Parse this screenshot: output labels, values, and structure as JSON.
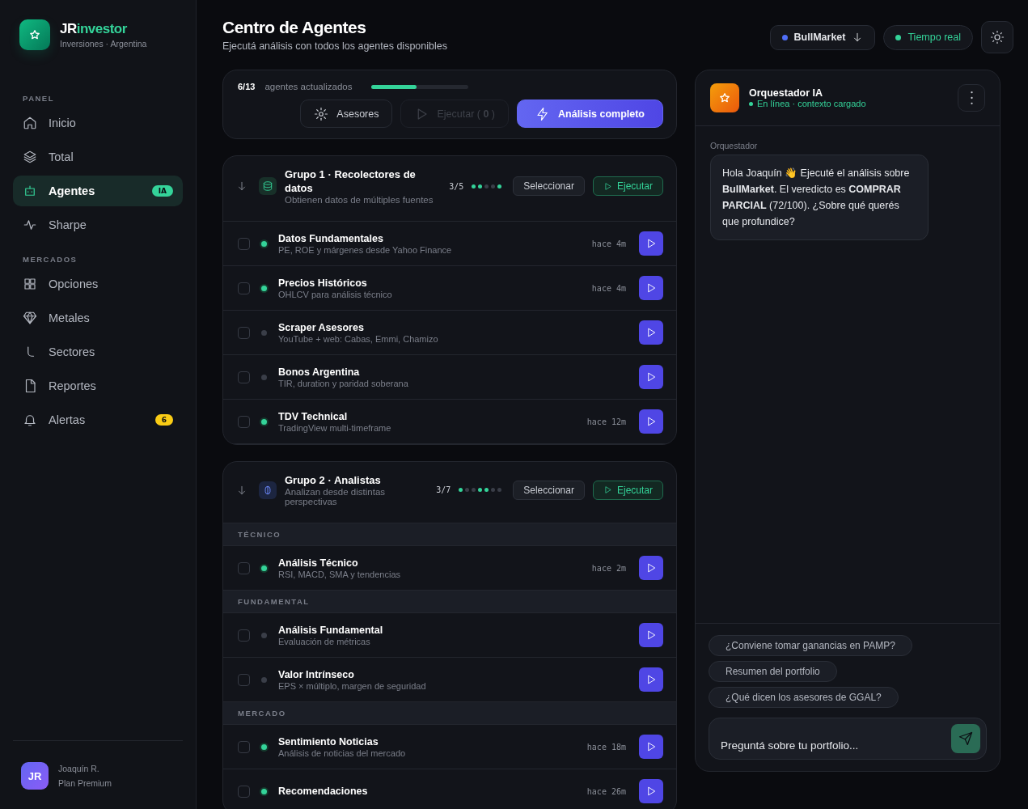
{
  "brand": {
    "name_main": "JR",
    "name_accent": "investor",
    "tagline": "Inversiones · Argentina"
  },
  "sidebar": {
    "sections": [
      {
        "label": "PANEL",
        "items": [
          {
            "label": "Inicio",
            "selected": false
          },
          {
            "label": "Total",
            "selected": false
          },
          {
            "label": "Agentes",
            "selected": true,
            "badge": {
              "text": "IA",
              "color": "#34d399"
            }
          },
          {
            "label": "Sharpe",
            "selected": false
          }
        ]
      },
      {
        "label": "MERCADOS",
        "items": [
          {
            "label": "Opciones",
            "selected": false
          },
          {
            "label": "Metales",
            "selected": false
          },
          {
            "label": "Sectores",
            "selected": false
          },
          {
            "label": "Reportes",
            "selected": false
          },
          {
            "label": "Alertas",
            "selected": false,
            "badge": {
              "text": "6",
              "color": "#facc15"
            }
          }
        ]
      }
    ],
    "user": {
      "initials": "JR",
      "name": "Joaquín R.",
      "plan": "Plan Premium"
    }
  },
  "header": {
    "title": "Centro de Agentes",
    "subtitle": "Ejecutá análisis con todos los agentes disponibles",
    "broker": {
      "label": "BullMarket",
      "color": "#4f6ef7"
    },
    "status": {
      "label": "Tiempo real",
      "color": "#34d399"
    }
  },
  "progress": {
    "count": "6/13",
    "label": "agentes actualizados",
    "level": 0.46,
    "buttons": [
      {
        "kind": "secondary",
        "label": "Asesores",
        "disabled": false
      },
      {
        "kind": "run",
        "label": "Ejecutar ( **0** )",
        "disabled": true
      },
      {
        "kind": "primary",
        "label": "Análisis completo",
        "disabled": false
      }
    ]
  },
  "groups": [
    {
      "title": "Grupo 1 · Recolectores de datos",
      "subtitle": "Obtienen datos de múltiples fuentes",
      "expanded": true,
      "count": "3/5",
      "select_label": "Seleccionar",
      "run_label": "Ejecutar",
      "dots": [
        {
          "on": true
        },
        {
          "on": true
        },
        {
          "on": false
        },
        {
          "on": false
        },
        {
          "on": true
        }
      ],
      "sections": [
        {
          "agents": [
            {
              "name": "Datos Fundamentales",
              "description": "PE, ROE y márgenes desde Yahoo Finance",
              "time": "hace 4m",
              "updated": true,
              "checked": false
            },
            {
              "name": "Precios Históricos",
              "description": "OHLCV para análisis técnico",
              "time": "hace 4m",
              "updated": true,
              "checked": false
            },
            {
              "name": "Scraper Asesores",
              "description": "YouTube + web: Cabas, Emmi, Chamizo",
              "updated": false,
              "checked": false
            },
            {
              "name": "Bonos Argentina",
              "description": "TIR, duration y paridad soberana",
              "updated": false,
              "checked": false
            },
            {
              "name": "TDV Technical",
              "description": "TradingView multi-timeframe",
              "time": "hace 12m",
              "updated": true,
              "checked": false
            }
          ]
        }
      ]
    },
    {
      "title": "Grupo 2 · Analistas",
      "subtitle": "Analizan desde distintas perspectivas",
      "expanded": true,
      "count": "3/7",
      "select_label": "Seleccionar",
      "run_label": "Ejecutar",
      "dots": [
        {
          "on": true
        },
        {
          "on": false
        },
        {
          "on": false
        },
        {
          "on": true
        },
        {
          "on": true
        },
        {
          "on": false
        },
        {
          "on": false
        }
      ],
      "sections": [
        {
          "label": "TÉCNICO",
          "agents": [
            {
              "name": "Análisis Técnico",
              "description": "RSI, MACD, SMA y tendencias",
              "time": "hace 2m",
              "updated": true,
              "checked": false
            }
          ]
        },
        {
          "label": "FUNDAMENTAL",
          "agents": [
            {
              "name": "Análisis Fundamental",
              "description": "Evaluación de métricas",
              "updated": false,
              "checked": false
            },
            {
              "name": "Valor Intrínseco",
              "description": "EPS × múltiplo, margen de seguridad",
              "updated": false,
              "checked": false
            }
          ]
        },
        {
          "label": "MERCADO",
          "agents": [
            {
              "name": "Sentimiento Noticias",
              "description": "Análisis de noticias del mercado",
              "time": "hace 18m",
              "updated": true,
              "checked": false
            },
            {
              "name": "Recomendaciones",
              "time": "hace 26m",
              "updated": true,
              "checked": false
            }
          ]
        }
      ]
    }
  ],
  "chat": {
    "title": "Orquestador IA",
    "status": "En línea · contexto cargado",
    "messages": [
      {
        "sender": "Orquestador",
        "text": "Hola Joaquín 👋 Ejecuté el análisis sobre **BullMarket**. El veredicto es **COMPRAR PARCIAL** (72/100). ¿Sobre qué querés que profundice?"
      }
    ],
    "suggestions": [
      "¿Conviene tomar ganancias en PAMP?",
      "Resumen del portfolio",
      "¿Qué dicen los asesores de GGAL?"
    ],
    "input": {
      "placeholder": "Preguntá sobre tu portfolio..."
    }
  }
}
